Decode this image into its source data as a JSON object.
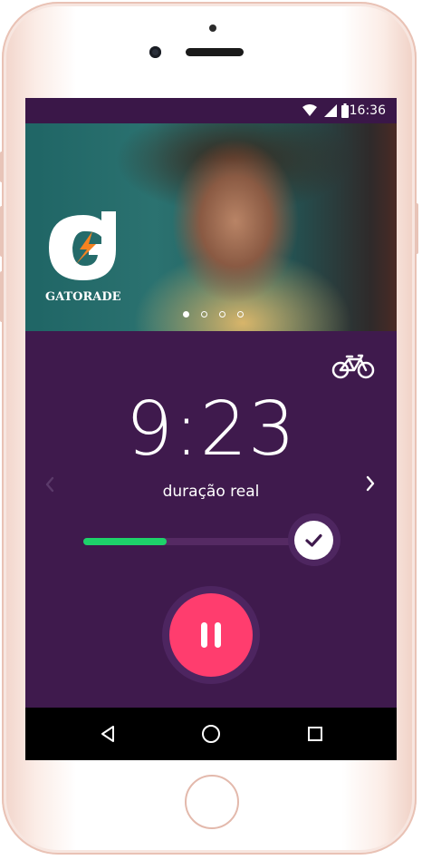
{
  "status_bar": {
    "time": "16:36"
  },
  "hero": {
    "brand": "GATORADE",
    "carousel": {
      "total": 4,
      "active": 0
    }
  },
  "workout": {
    "activity_icon": "bicycle-icon",
    "time": "9:23",
    "label": "duração real",
    "progress": 0.36
  },
  "colors": {
    "background": "#3f1a4d",
    "accent_pause": "#ff3d6e",
    "progress": "#1ed16a",
    "brand_orange": "#f58220"
  },
  "nav": {
    "back_icon": "back-triangle-icon",
    "home_icon": "home-circle-icon",
    "recent_icon": "recent-square-icon"
  }
}
